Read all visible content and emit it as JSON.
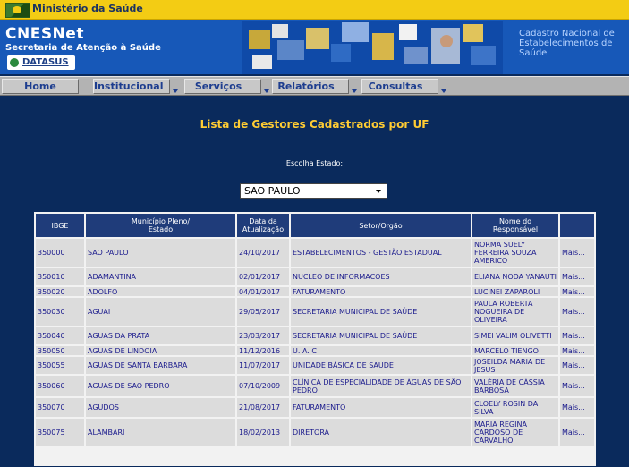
{
  "topbar": {
    "org": "Ministério da Saúde"
  },
  "header": {
    "title": "CNESNet",
    "subtitle": "Secretaria de Atenção à Saúde",
    "datasus": "DATASUS",
    "cadastro_line1": "Cadastro Nacional de",
    "cadastro_line2": "Estabelecimentos de",
    "cadastro_line3": "Saúde"
  },
  "menu": [
    {
      "label": "Home"
    },
    {
      "label": "Institucional"
    },
    {
      "label": "Serviços"
    },
    {
      "label": "Relatórios"
    },
    {
      "label": "Consultas"
    }
  ],
  "page": {
    "title": "Lista de Gestores Cadastrados por UF",
    "state_label": "Escolha Estado:",
    "selected_state": "SAO PAULO"
  },
  "table": {
    "headers": {
      "ibge": "IBGE",
      "municipio_1": "Município Pleno/",
      "municipio_2": "Estado",
      "data_1": "Data da",
      "data_2": "Atualização",
      "setor": "Setor/Orgão",
      "nome_1": "Nome do",
      "nome_2": "Responsável"
    },
    "rows": [
      {
        "ibge": "350000",
        "municipio": "SAO PAULO",
        "data": "24/10/2017",
        "setor": "ESTABELECIMENTOS - GESTÃO ESTADUAL",
        "nome": "NORMA SUELY FERREIRA SOUZA AMERICO",
        "mais": "Mais..."
      },
      {
        "ibge": "350010",
        "municipio": "ADAMANTINA",
        "data": "02/01/2017",
        "setor": "NUCLEO DE INFORMACOES",
        "nome": "ELIANA NODA YANAUTI",
        "mais": "Mais..."
      },
      {
        "ibge": "350020",
        "municipio": "ADOLFO",
        "data": "04/01/2017",
        "setor": "FATURAMENTO",
        "nome": "LUCINEI ZAPAROLI",
        "mais": "Mais..."
      },
      {
        "ibge": "350030",
        "municipio": "AGUAI",
        "data": "29/05/2017",
        "setor": "SECRETARIA MUNICIPAL DE SAÚDE",
        "nome": "PAULA ROBERTA NOGUEIRA DE OLIVEIRA",
        "mais": "Mais..."
      },
      {
        "ibge": "350040",
        "municipio": "AGUAS DA PRATA",
        "data": "23/03/2017",
        "setor": "SECRETARIA MUNICIPAL DE SAÚDE",
        "nome": "SIMEI VALIM OLIVETTI",
        "mais": "Mais..."
      },
      {
        "ibge": "350050",
        "municipio": "AGUAS DE LINDOIA",
        "data": "11/12/2016",
        "setor": "U. A. C",
        "nome": "MARCELO TIENGO",
        "mais": "Mais..."
      },
      {
        "ibge": "350055",
        "municipio": "AGUAS DE SANTA BARBARA",
        "data": "11/07/2017",
        "setor": "UNIDADE BÁSICA DE SAUDE",
        "nome": "JOSEILDA MARIA DE JESUS",
        "mais": "Mais..."
      },
      {
        "ibge": "350060",
        "municipio": "AGUAS DE SAO PEDRO",
        "data": "07/10/2009",
        "setor": "CLÍNICA DE ESPECIALIDADE DE ÁGUAS DE SÃO PEDRO",
        "nome": "VALÉRIA DE CÁSSIA BARBOSA",
        "mais": "Mais..."
      },
      {
        "ibge": "350070",
        "municipio": "AGUDOS",
        "data": "21/08/2017",
        "setor": "FATURAMENTO",
        "nome": "CLOELY ROSIN DA SILVA",
        "mais": "Mais..."
      },
      {
        "ibge": "350075",
        "municipio": "ALAMBARI",
        "data": "18/02/2013",
        "setor": "DIRETORA",
        "nome": "MARIA REGINA CARDOSO DE CARVALHO",
        "mais": "Mais..."
      }
    ]
  }
}
